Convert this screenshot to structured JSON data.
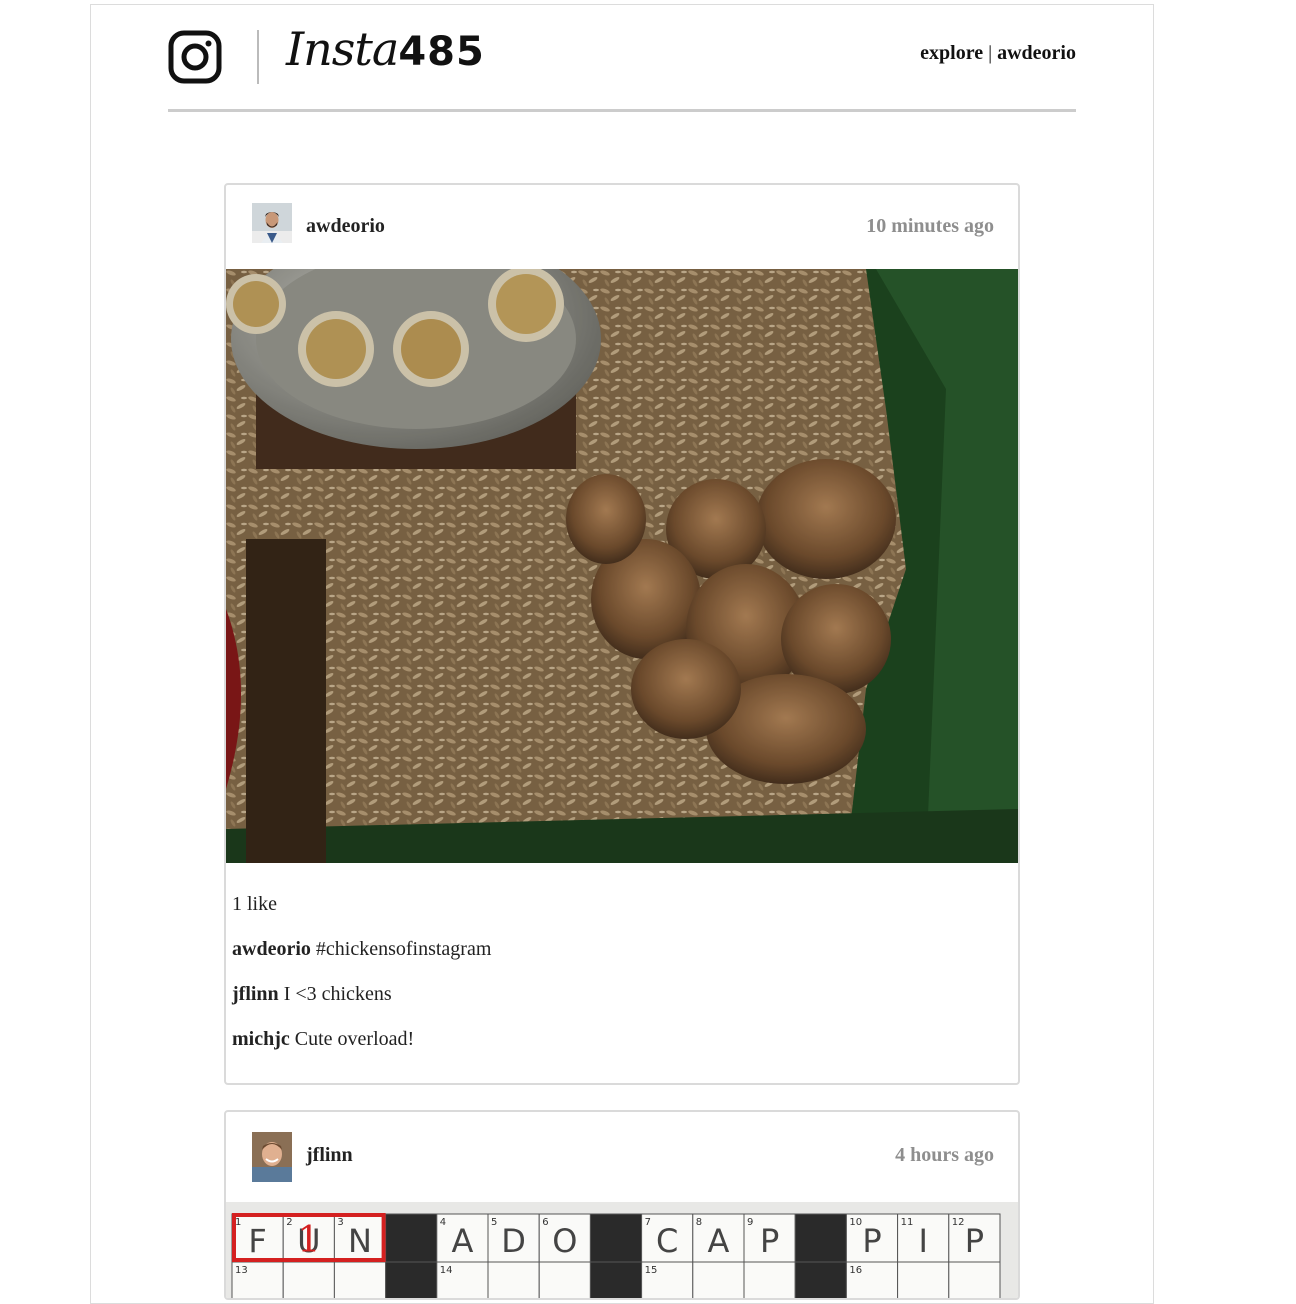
{
  "header": {
    "brand_script": "Insta",
    "brand_number": "485",
    "nav_explore": "explore",
    "nav_separator": "|",
    "nav_user": "awdeorio"
  },
  "posts": [
    {
      "owner": "awdeorio",
      "timestamp": "10 minutes ago",
      "likes": "1 like",
      "comments": [
        {
          "owner": "awdeorio",
          "text": "#chickensofinstagram"
        },
        {
          "owner": "jflinn",
          "text": "I <3 chickens"
        },
        {
          "owner": "michjc",
          "text": "Cute overload!"
        }
      ]
    },
    {
      "owner": "jflinn",
      "timestamp": "4 hours ago",
      "crossword": {
        "row1": [
          "F",
          "U",
          "N",
          "",
          "A",
          "D",
          "O",
          "",
          "C",
          "A",
          "P",
          "",
          "P",
          "I",
          "P"
        ],
        "row1_numbers": [
          "1",
          "2",
          "3",
          "",
          "4",
          "5",
          "6",
          "",
          "7",
          "8",
          "9",
          "",
          "10",
          "11",
          "12"
        ],
        "row2_numbers": [
          "13",
          "",
          "",
          "",
          "14",
          "",
          "",
          "",
          "15",
          "",
          "",
          "",
          "16",
          "",
          ""
        ],
        "highlight_label": "1"
      }
    }
  ]
}
